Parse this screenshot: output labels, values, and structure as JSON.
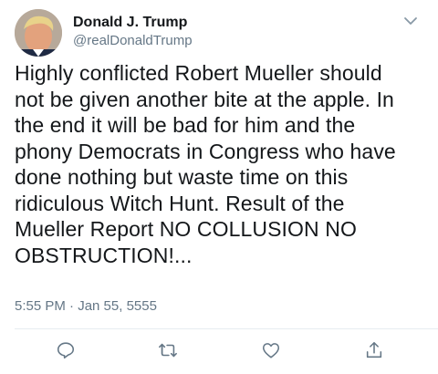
{
  "user": {
    "display_name": "Donald J. Trump",
    "handle": "@realDonaldTrump"
  },
  "tweet": {
    "text": "Highly conflicted Robert Mueller should\nnot be given another bite at the apple. In\nthe end it will be bad for him and the\nphony Democrats in Congress who have\ndone nothing but waste time on this\nridiculous Witch Hunt. Result of the\nMueller Report NO COLLUSION NO\nOBSTRUCTION!...",
    "timestamp": "5:55 PM · Jan 55, 5555"
  },
  "icons": {
    "more": "chevron-down-icon",
    "reply": "reply-icon",
    "retweet": "retweet-icon",
    "like": "heart-icon",
    "share": "share-icon"
  },
  "colors": {
    "text": "#14171a",
    "secondary": "#657786",
    "divider": "#e6ecf0"
  }
}
